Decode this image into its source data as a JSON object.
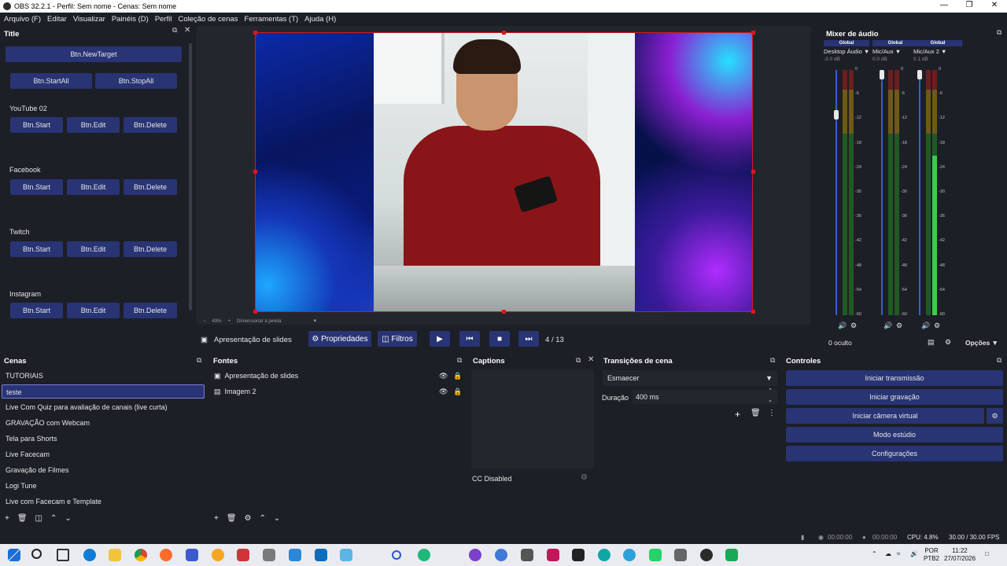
{
  "window": {
    "title": "OBS 32.2.1 - Perfil: Sem nome - Cenas: Sem nome"
  },
  "menu": [
    "Arquivo (F)",
    "Editar",
    "Visualizar",
    "Painéis (D)",
    "Perfil",
    "Coleção de cenas",
    "Ferramentas (T)",
    "Ajuda (H)"
  ],
  "left_dock": {
    "title": "Title",
    "new_target": "Btn.NewTarget",
    "start_all": "Btn.StartAll",
    "stop_all": "Btn.StopAll",
    "groups": [
      {
        "name": "YouTube 02",
        "start": "Btn.Start",
        "edit": "Btn.Edit",
        "delete": "Btn.Delete"
      },
      {
        "name": "Facebook",
        "start": "Btn.Start",
        "edit": "Btn.Edit",
        "delete": "Btn.Delete"
      },
      {
        "name": "Twitch",
        "start": "Btn.Start",
        "edit": "Btn.Edit",
        "delete": "Btn.Delete"
      },
      {
        "name": "Instagram",
        "start": "Btn.Start",
        "edit": "Btn.Edit",
        "delete": "Btn.Delete"
      }
    ]
  },
  "preview": {
    "zoom": "49%",
    "zoom_mode": "Dimensionar à janela"
  },
  "media": {
    "source": "Apresentação de slides",
    "properties": "Propriedades",
    "filters": "Filtros",
    "slide_current": "4",
    "slide_sep": "/",
    "slide_total": "13"
  },
  "mixer": {
    "title": "Mixer de áudio",
    "channels": [
      {
        "badge": "Global",
        "name": "Desktop Áudio",
        "db": "-3.0 dB",
        "fader": 0.83
      },
      {
        "badge": "Global",
        "name": "Mic/Aux",
        "db": "0.0 dB",
        "fader": 1.0
      },
      {
        "badge": "Global",
        "name": "Mic/Aux 2",
        "db": "0.1 dB",
        "fader": 1.0
      }
    ],
    "scale": [
      "0",
      "-6",
      "-12",
      "-18",
      "-24",
      "-30",
      "-36",
      "-42",
      "-48",
      "-54",
      "-60"
    ],
    "hidden": "0 oculto",
    "options": "Opções"
  },
  "scenes": {
    "title": "Cenas",
    "items": [
      "TUTORIAIS",
      "teste",
      "Live Com Quiz para avaliação de canais (live curta)",
      "GRAVAÇÃO com Webcam",
      "Tela para Shorts",
      "Live Facecam",
      "Gravação de Filmes",
      "Logi Tune",
      "Live com Facecam e Template"
    ],
    "selected_index": 1
  },
  "sources": {
    "title": "Fontes",
    "items": [
      "Apresentação de slides",
      "Imagem 2"
    ]
  },
  "captions": {
    "title": "Captions",
    "status": "CC Disabled"
  },
  "transitions": {
    "title": "Transições de cena",
    "selected": "Esmaecer",
    "duration_label": "Duração",
    "duration": "400 ms"
  },
  "controls": {
    "title": "Controles",
    "buttons": [
      "Iniciar transmissão",
      "Iniciar gravação",
      "Iniciar câmera virtual",
      "Modo estúdio",
      "Configurações"
    ]
  },
  "status": {
    "stream_time": "00:00:00",
    "rec_time": "00:00:00",
    "cpu": "CPU: 4.8%",
    "fps": "30.00 / 30.00 FPS"
  },
  "taskbar": {
    "lang1": "POR",
    "lang2": "PTB2",
    "time": "11:22",
    "date": "27/07/2026"
  }
}
